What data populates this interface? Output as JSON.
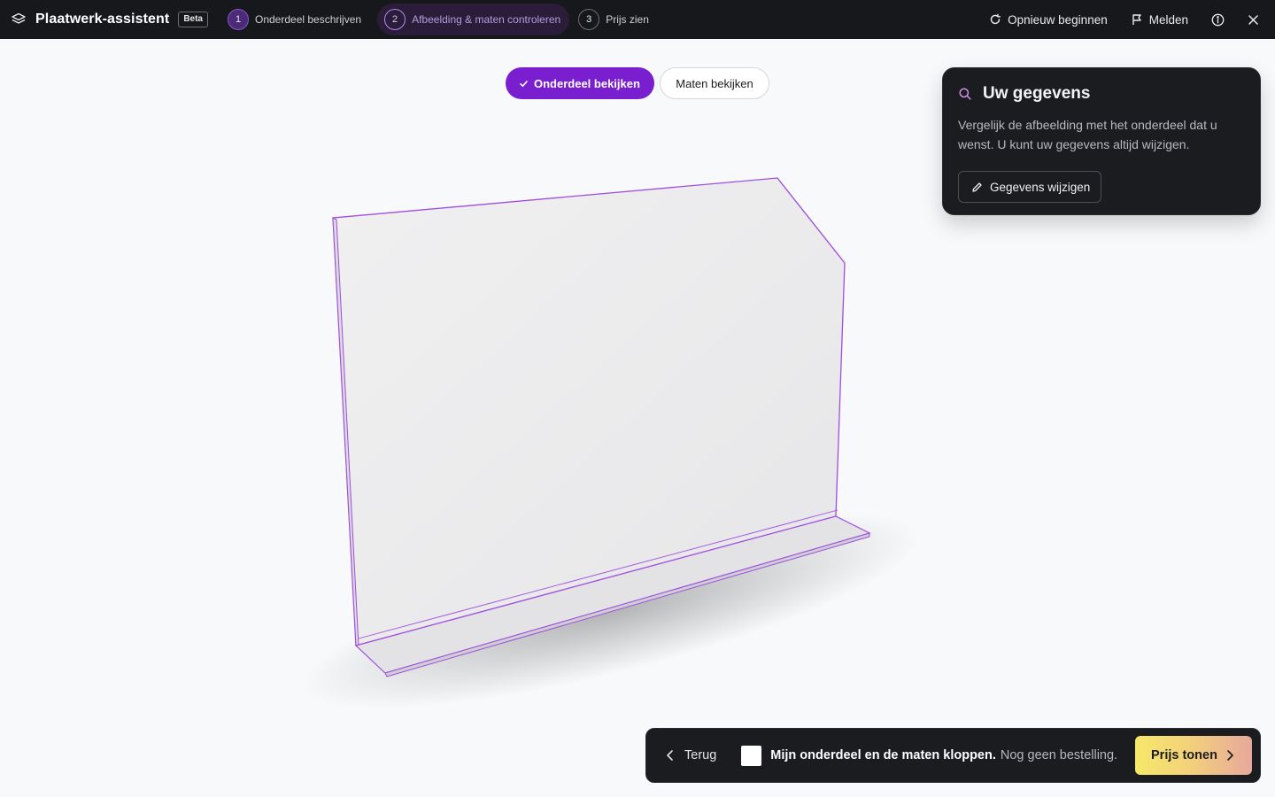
{
  "app": {
    "title": "Plaatwerk-assistent",
    "badge": "Beta"
  },
  "steps": [
    {
      "number": "1",
      "label": "Onderdeel beschrijven",
      "state": "done"
    },
    {
      "number": "2",
      "label": "Afbeelding & maten controleren",
      "state": "active"
    },
    {
      "number": "3",
      "label": "Prijs zien",
      "state": "upcoming"
    }
  ],
  "top_actions": {
    "restart_label": "Opnieuw beginnen",
    "report_label": "Melden",
    "info_icon": "info-icon",
    "close_icon": "close-icon"
  },
  "view_toggle": {
    "part_label": "Onderdeel bekijken",
    "dimensions_label": "Maten bekijken",
    "selected": "part"
  },
  "info_panel": {
    "title": "Uw gegevens",
    "text": "Vergelijk de afbeelding met het onderdeel dat u wenst. U kunt uw gegevens altijd wijzigen.",
    "edit_label": "Gegevens wijzigen"
  },
  "bottom_bar": {
    "back_label": "Terug",
    "confirm_strong": "Mijn onderdeel en de maten kloppen.",
    "confirm_muted": "Nog geen bestelling.",
    "confirm_checked": false,
    "price_label": "Prijs tonen"
  },
  "colors": {
    "accent": "#7a1fd0",
    "edge": "#a04de0",
    "topbar": "#17181b",
    "panel": "#1b1c20",
    "price_gradient_start": "#f6e86a",
    "price_gradient_end": "#e7a89c"
  }
}
